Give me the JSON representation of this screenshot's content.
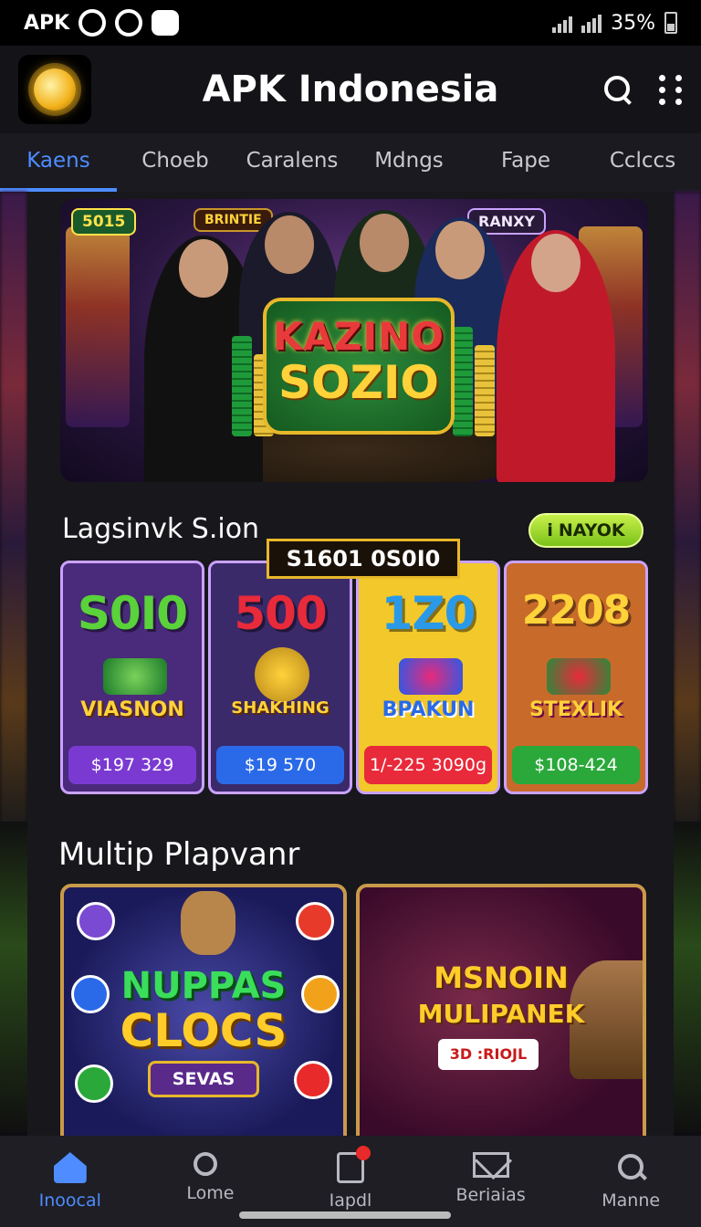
{
  "status_bar": {
    "left_text": "APK",
    "battery": "35%"
  },
  "app": {
    "title": "APK Indonesia"
  },
  "tabs": [
    {
      "label": "Kaens",
      "active": true
    },
    {
      "label": "Choeb"
    },
    {
      "label": "Caralens"
    },
    {
      "label": "Mdngs"
    },
    {
      "label": "Fape"
    },
    {
      "label": "Cclccs"
    }
  ],
  "hero": {
    "badge_left": "5015",
    "badge_mid": "BRINTIE",
    "badge_right": "RANXY",
    "title_line1": "KAZINO",
    "title_line2": "SOZIO"
  },
  "section1": {
    "title": "Lagsinvk S.ion",
    "pill_label": "NAYOK",
    "ribbon": "S1601 0S0I0",
    "cards": [
      {
        "number": "S0I0",
        "name": "VIASNON",
        "price": "$197 329",
        "colors": {
          "bg": "#4a2a7a",
          "num": "#5ad23a",
          "price_bg": "#7a3ad2"
        }
      },
      {
        "number": "500",
        "name": "SHAKHING",
        "price": "$19 570",
        "colors": {
          "bg": "#3a2a6a",
          "num": "#e82a3a",
          "price_bg": "#2a6ae8"
        }
      },
      {
        "number": "1Z0",
        "name": "BPAKUN",
        "price": "1/-225 3090g",
        "colors": {
          "bg": "#f2c82a",
          "num": "#2a9ae8",
          "price_bg": "#e82a3a"
        }
      },
      {
        "number": "2208",
        "name": "STEXLIK",
        "price": "$108-424",
        "colors": {
          "bg": "#c86a2a",
          "num": "#ffd23a",
          "price_bg": "#2aa83a"
        }
      }
    ]
  },
  "section2": {
    "title": "Multip Plapvanr",
    "games": [
      {
        "line1": "NUPPAS",
        "line2": "CLOCS",
        "tag": "SEVAS"
      },
      {
        "line1": "MSNOIN",
        "line2": "MULIPANEK",
        "tag": "3D :RIOJL"
      }
    ]
  },
  "bottom_nav": [
    {
      "label": "Inoocal",
      "icon": "home-icon",
      "active": true
    },
    {
      "label": "Lome",
      "icon": "key-icon"
    },
    {
      "label": "Iapdl",
      "icon": "clipboard-icon"
    },
    {
      "label": "Beriaias",
      "icon": "mail-icon"
    },
    {
      "label": "Manne",
      "icon": "search-icon"
    }
  ],
  "colors": {
    "accent": "#4e8cff",
    "background": "#0d0d12",
    "gold": "#e8b82a"
  }
}
